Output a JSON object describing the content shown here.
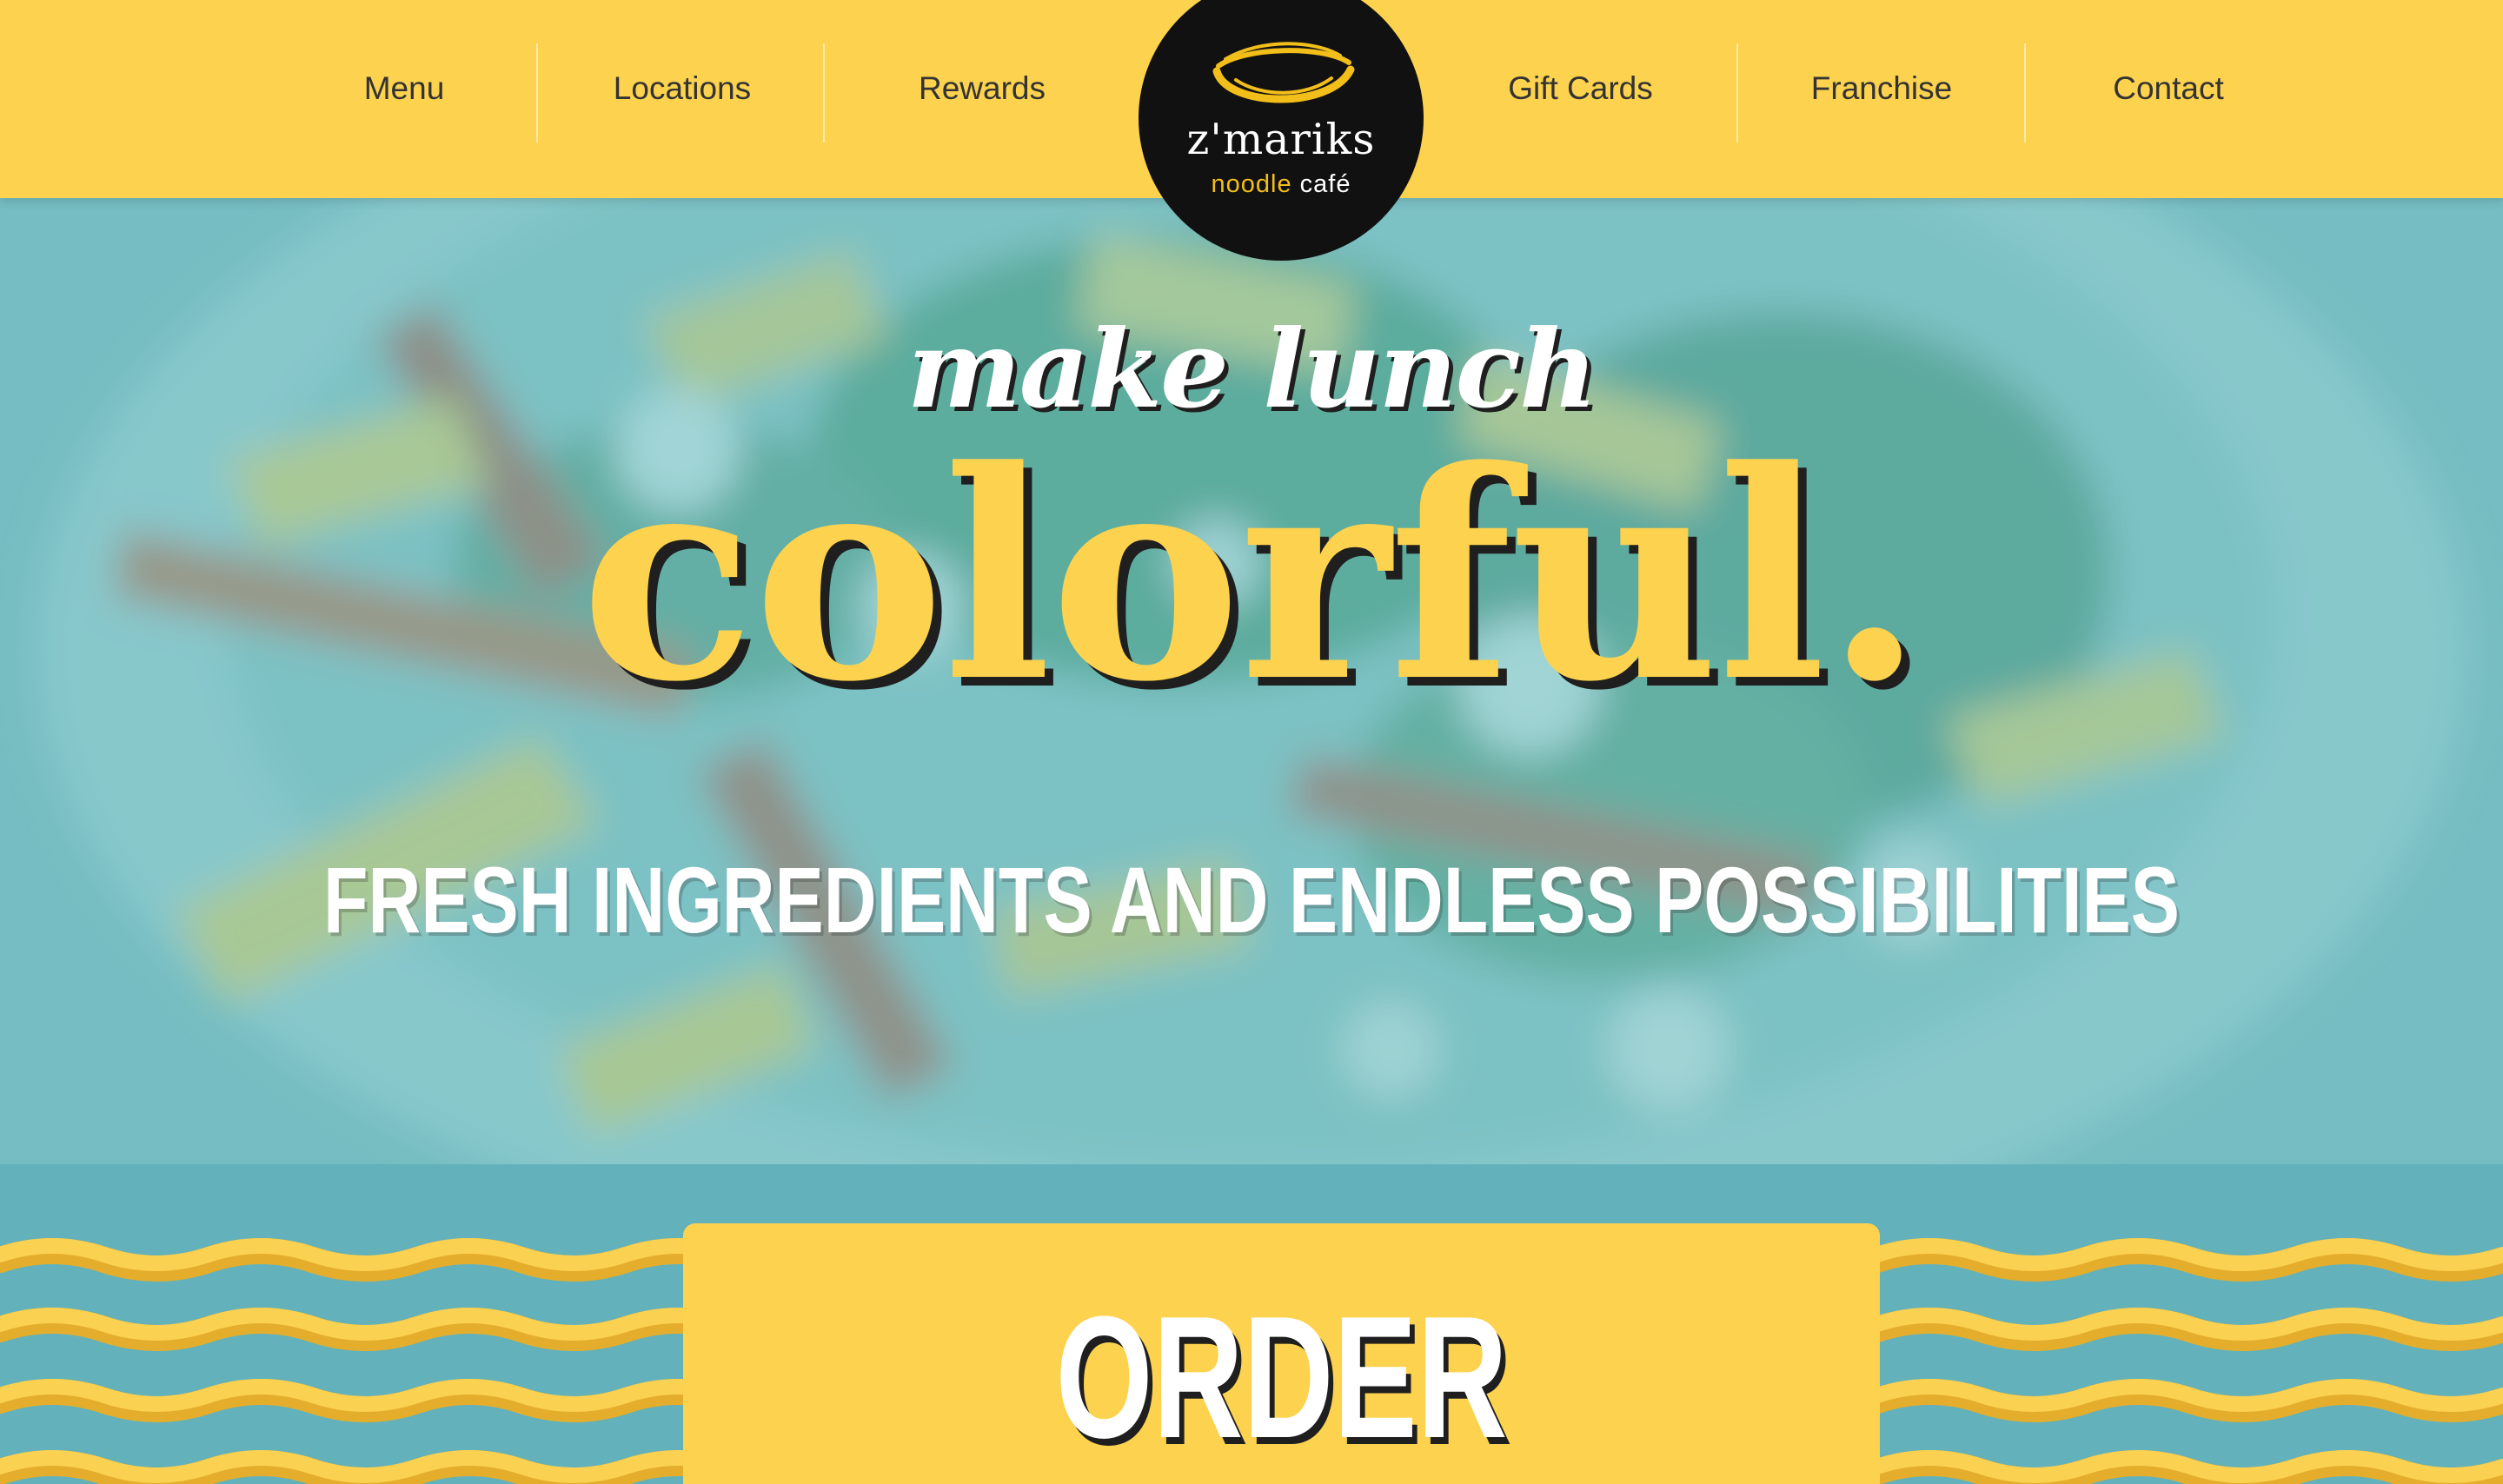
{
  "nav": {
    "left_items": [
      {
        "label": "Menu"
      },
      {
        "label": "Locations"
      },
      {
        "label": "Rewards"
      }
    ],
    "right_items": [
      {
        "label": "Gift Cards"
      },
      {
        "label": "Franchise"
      },
      {
        "label": "Contact"
      }
    ]
  },
  "logo": {
    "name": "z'mariks",
    "sub_word1": "noodle",
    "sub_word2": "café"
  },
  "hero": {
    "kicker": "make lunch",
    "headline": "colorful.",
    "tagline": "FRESH INGREDIENTS AND ENDLESS POSSIBILITIES"
  },
  "order": {
    "label": "ORDER"
  },
  "colors": {
    "brand_yellow": "#fdd24e",
    "teal": "#63b1bb",
    "logo_black": "#111111",
    "text_dark": "#333333",
    "noodle_gold": "#f2be1a"
  }
}
